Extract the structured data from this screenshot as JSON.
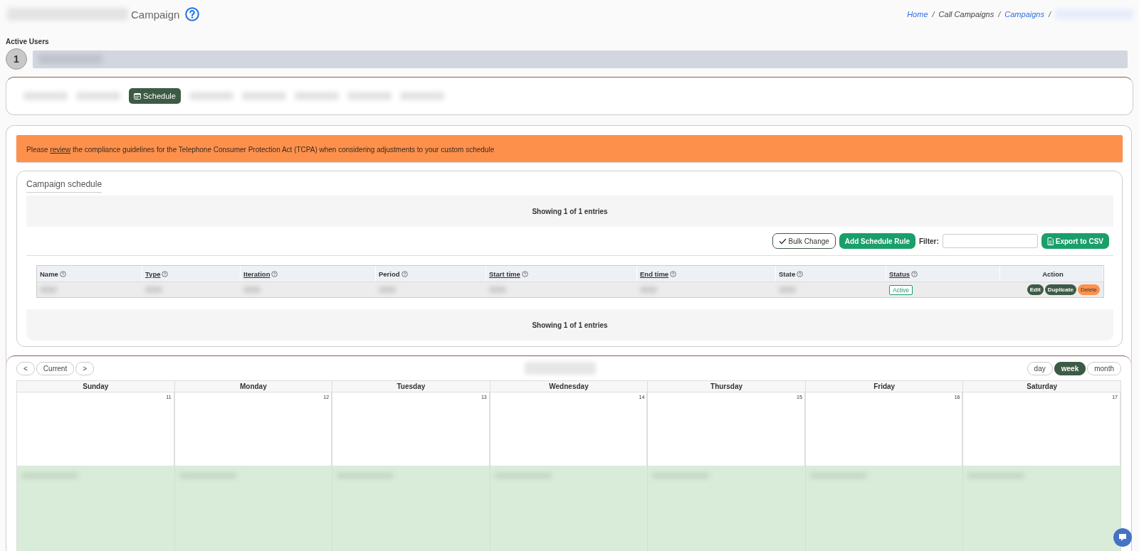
{
  "header": {
    "title": "Campaign",
    "separator": "/",
    "breadcrumb": [
      {
        "label": "Home",
        "link": true
      },
      {
        "label": "Call Campaigns",
        "link": false
      },
      {
        "label": "Campaigns",
        "link": true
      }
    ]
  },
  "active_users": {
    "label": "Active Users",
    "count": "1"
  },
  "tabs": [
    {
      "kind": "blurred",
      "selected": false
    },
    {
      "kind": "blurred",
      "selected": false
    },
    {
      "kind": "tab",
      "label": "Schedule",
      "selected": true
    },
    {
      "kind": "blurred",
      "selected": false
    },
    {
      "kind": "blurred",
      "selected": false
    },
    {
      "kind": "blurred",
      "selected": false
    },
    {
      "kind": "blurred",
      "selected": false
    },
    {
      "kind": "blurred",
      "selected": false
    }
  ],
  "notice": {
    "before": "Please ",
    "link": "review",
    "after": " the compliance guidelines for the Telephone Consumer Protection Act (TCPA) when considering adjustments to your custom schedule"
  },
  "schedule": {
    "title": "Campaign schedule",
    "info_top": "Showing 1 of 1 entries",
    "bulk_button": "Bulk Change",
    "add_button": "Add Schedule Rule",
    "filter_label": "Filter:",
    "export_button": "Export to CSV",
    "columns": [
      {
        "label": "Name",
        "sortable": false
      },
      {
        "label": "Type",
        "sortable": true
      },
      {
        "label": "Iteration",
        "sortable": true
      },
      {
        "label": "Period",
        "sortable": false
      },
      {
        "label": "Start time",
        "sortable": true
      },
      {
        "label": "End time",
        "sortable": true
      },
      {
        "label": "State",
        "sortable": false
      },
      {
        "label": "Status",
        "sortable": true
      },
      {
        "label": "Action",
        "sortable": false
      }
    ],
    "rows": [
      {
        "status": "Active",
        "actions": [
          {
            "label": "Edit",
            "kind": "dark"
          },
          {
            "label": "Duplicate",
            "kind": "dark"
          },
          {
            "label": "Delete",
            "kind": "danger"
          }
        ]
      }
    ],
    "info_bottom": "Showing 1 of 1 entries"
  },
  "calendar": {
    "nav": [
      "<",
      "Current",
      ">"
    ],
    "views": [
      {
        "label": "day",
        "selected": false
      },
      {
        "label": "week",
        "selected": true
      },
      {
        "label": "month",
        "selected": false
      }
    ],
    "days": [
      {
        "name": "Sunday",
        "date": "11"
      },
      {
        "name": "Monday",
        "date": "12"
      },
      {
        "name": "Tuesday",
        "date": "13"
      },
      {
        "name": "Wednesday",
        "date": "14"
      },
      {
        "name": "Thursday",
        "date": "15"
      },
      {
        "name": "Friday",
        "date": "16"
      },
      {
        "name": "Saturday",
        "date": "17"
      }
    ]
  }
}
